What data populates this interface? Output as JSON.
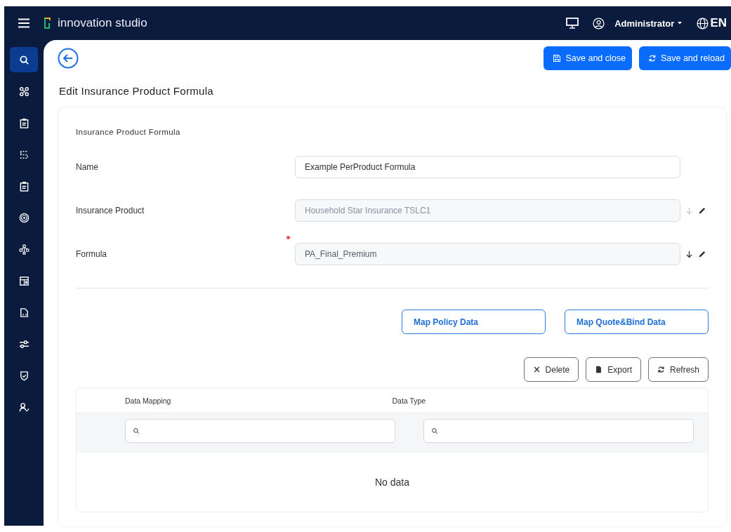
{
  "header": {
    "app_name": "innovation studio",
    "user": "Administrator",
    "language": "EN"
  },
  "sidebar": {
    "items": [
      {
        "selected": true
      },
      {
        "selected": false
      },
      {
        "selected": false
      },
      {
        "selected": false
      },
      {
        "selected": false
      },
      {
        "selected": false
      },
      {
        "selected": false
      },
      {
        "selected": false
      },
      {
        "selected": false
      },
      {
        "selected": false
      },
      {
        "selected": false
      },
      {
        "selected": false
      }
    ]
  },
  "toolbar": {
    "buttons": [
      "Save and close",
      "Save and reload"
    ]
  },
  "page_title": "Edit Insurance Product Formula",
  "form": {
    "section_title": "Insurance Product Formula",
    "fields": [
      {
        "label": "Name",
        "value": "Example PerProduct Formula",
        "kind": "text",
        "disabled": false,
        "required": false
      },
      {
        "label": "Insurance Product",
        "value": "Household Star Insurance TSLC1",
        "kind": "lookup",
        "disabled": true,
        "required": false
      },
      {
        "label": "Formula",
        "value": "PA_Final_Premium",
        "kind": "lookup",
        "disabled": false,
        "required": true
      }
    ]
  },
  "map_buttons": [
    "Map Policy Data",
    "Map Quote&Bind Data"
  ],
  "table": {
    "actions": [
      "Delete",
      "Export",
      "Refresh"
    ],
    "columns": [
      "Data Mapping",
      "Data Type"
    ],
    "empty_text": "No data"
  }
}
